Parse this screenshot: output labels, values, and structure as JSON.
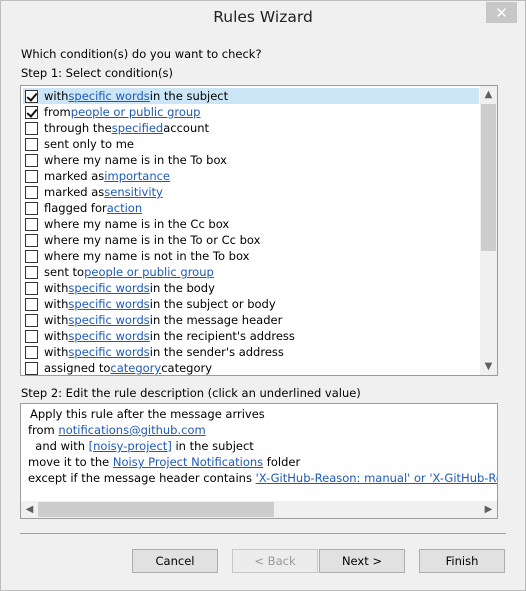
{
  "window": {
    "title": "Rules Wizard",
    "close_glyph": "✕"
  },
  "question": "Which condition(s) do you want to check?",
  "step1_label": "Step 1: Select condition(s)",
  "conditions": [
    {
      "checked": true,
      "pre": "with ",
      "link": "specific words",
      "post": " in the subject",
      "selected": true
    },
    {
      "checked": true,
      "pre": "from ",
      "link": "people or public group",
      "post": ""
    },
    {
      "checked": false,
      "pre": "through the ",
      "link": "specified",
      "post": " account"
    },
    {
      "checked": false,
      "pre": "sent only to me",
      "link": "",
      "post": ""
    },
    {
      "checked": false,
      "pre": "where my name is in the To box",
      "link": "",
      "post": ""
    },
    {
      "checked": false,
      "pre": "marked as ",
      "link": "importance",
      "post": ""
    },
    {
      "checked": false,
      "pre": "marked as ",
      "link": "sensitivity",
      "post": ""
    },
    {
      "checked": false,
      "pre": "flagged for ",
      "link": "action",
      "post": ""
    },
    {
      "checked": false,
      "pre": "where my name is in the Cc box",
      "link": "",
      "post": ""
    },
    {
      "checked": false,
      "pre": "where my name is in the To or Cc box",
      "link": "",
      "post": ""
    },
    {
      "checked": false,
      "pre": "where my name is not in the To box",
      "link": "",
      "post": ""
    },
    {
      "checked": false,
      "pre": "sent to ",
      "link": "people or public group",
      "post": ""
    },
    {
      "checked": false,
      "pre": "with ",
      "link": "specific words",
      "post": " in the body"
    },
    {
      "checked": false,
      "pre": "with ",
      "link": "specific words",
      "post": " in the subject or body"
    },
    {
      "checked": false,
      "pre": "with ",
      "link": "specific words",
      "post": " in the message header"
    },
    {
      "checked": false,
      "pre": "with ",
      "link": "specific words",
      "post": " in the recipient's address"
    },
    {
      "checked": false,
      "pre": "with ",
      "link": "specific words",
      "post": " in the sender's address"
    },
    {
      "checked": false,
      "pre": "assigned to ",
      "link": "category",
      "post": " category"
    }
  ],
  "step2_label": "Step 2: Edit the rule description (click an underlined value)",
  "description": [
    {
      "pre": "Apply this rule after the message arrives",
      "link": "",
      "post": ""
    },
    {
      "pre": "from ",
      "link": "notifications@github.com",
      "post": ""
    },
    {
      "pre": "  and with ",
      "link": "[noisy-project]",
      "post": " in the subject"
    },
    {
      "pre": "move it to the ",
      "link": "Noisy Project Notifications",
      "post": " folder"
    },
    {
      "pre": "except if the message header contains ",
      "link": "'X-GitHub-Reason: manual' or 'X-GitHub-Reason:",
      "post": ""
    }
  ],
  "scroll_arrows": {
    "up": "▲",
    "down": "▼",
    "left": "◀",
    "right": "▶"
  },
  "buttons": {
    "cancel": "Cancel",
    "back": "< Back",
    "next": "Next >",
    "finish": "Finish"
  }
}
